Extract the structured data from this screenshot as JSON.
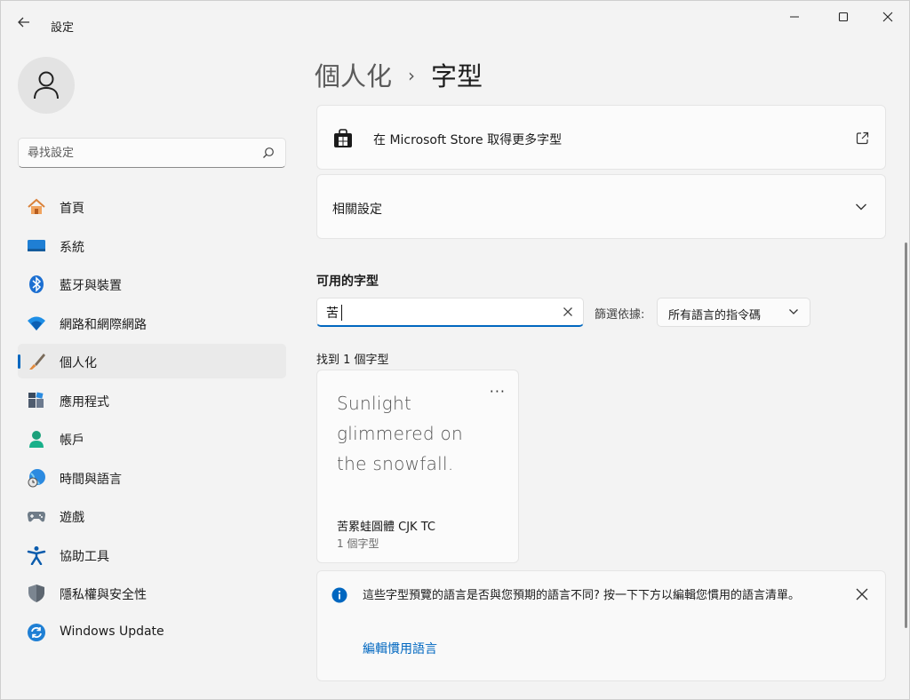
{
  "window": {
    "title": "設定"
  },
  "sidebar": {
    "search_placeholder": "尋找設定",
    "items": [
      {
        "label": "首頁",
        "icon": "home-icon"
      },
      {
        "label": "系統",
        "icon": "system-icon"
      },
      {
        "label": "藍牙與裝置",
        "icon": "bluetooth-icon"
      },
      {
        "label": "網路和網際網路",
        "icon": "wifi-icon"
      },
      {
        "label": "個人化",
        "icon": "brush-icon",
        "selected": true
      },
      {
        "label": "應用程式",
        "icon": "apps-icon"
      },
      {
        "label": "帳戶",
        "icon": "account-icon"
      },
      {
        "label": "時間與語言",
        "icon": "globe-clock-icon"
      },
      {
        "label": "遊戲",
        "icon": "gamepad-icon"
      },
      {
        "label": "協助工具",
        "icon": "accessibility-icon"
      },
      {
        "label": "隱私權與安全性",
        "icon": "shield-icon"
      },
      {
        "label": "Windows Update",
        "icon": "update-icon"
      }
    ]
  },
  "main": {
    "breadcrumb": {
      "parent": "個人化",
      "separator": "›",
      "current": "字型"
    },
    "store_card": {
      "label": "在 Microsoft Store 取得更多字型"
    },
    "related_card": {
      "label": "相關設定"
    },
    "available_fonts": {
      "title": "可用的字型",
      "search_value": "苦",
      "filter_label": "篩選依據:",
      "filter_value": "所有語言的指令碼",
      "found_text": "找到 1 個字型"
    },
    "font_card": {
      "preview_text": "Sunlight glimmered on the snowfall.",
      "name": "苦累蛙圓體 CJK TC",
      "count": "1 個字型"
    },
    "info_bar": {
      "message": "這些字型預覽的語言是否與您預期的語言不同? 按一下下方以編輯您慣用的語言清單。",
      "link": "編輯慣用語言"
    }
  },
  "colors": {
    "accent": "#0067c0",
    "background": "#f3f3f3",
    "card": "#fbfbfb"
  }
}
